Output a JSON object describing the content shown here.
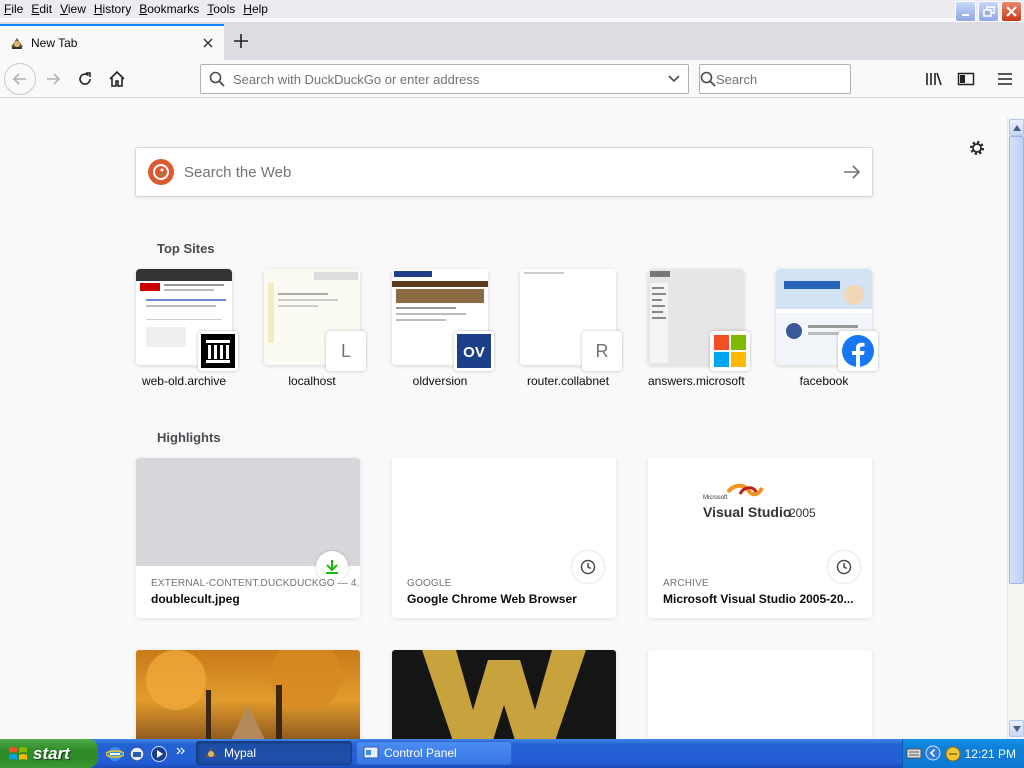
{
  "menu": [
    {
      "label": "File",
      "key": "F",
      "rest": "ile"
    },
    {
      "label": "Edit",
      "key": "E",
      "rest": "dit"
    },
    {
      "label": "View",
      "key": "V",
      "rest": "iew"
    },
    {
      "label": "History",
      "key": "H",
      "rest": "istory"
    },
    {
      "label": "Bookmarks",
      "key": "B",
      "rest": "ookmarks"
    },
    {
      "label": "Tools",
      "key": "T",
      "rest": "ools"
    },
    {
      "label": "Help",
      "key": "H",
      "rest": "elp"
    }
  ],
  "tab": {
    "title": "New Tab"
  },
  "urlbar": {
    "placeholder": "Search with DuckDuckGo or enter address"
  },
  "searchbar": {
    "placeholder": "Search"
  },
  "websearch": {
    "placeholder": "Search the Web"
  },
  "sections": {
    "top_sites": "Top Sites",
    "highlights": "Highlights"
  },
  "top_sites": [
    {
      "label": "web-old.archive",
      "icon": "archive-icon"
    },
    {
      "label": "localhost",
      "icon": "letter-icon",
      "letter": "L"
    },
    {
      "label": "oldversion",
      "icon": "oldversion-icon",
      "letter": "OV"
    },
    {
      "label": "router.collabnet",
      "icon": "letter-icon",
      "letter": "R"
    },
    {
      "label": "answers.microsoft",
      "icon": "microsoft-icon"
    },
    {
      "label": "facebook",
      "icon": "facebook-icon"
    }
  ],
  "highlights": [
    {
      "source": "EXTERNAL-CONTENT.DUCKDUCKGO — 4...",
      "title": "doublecult.jpeg",
      "badge": "download-icon"
    },
    {
      "source": "GOOGLE",
      "title": "Google Chrome Web Browser",
      "badge": "clock-icon"
    },
    {
      "source": "ARCHIVE",
      "title": "Microsoft Visual Studio 2005-20...",
      "badge": "clock-icon",
      "preview_brand": "Microsoft",
      "preview_product": "Visual Studio",
      "preview_year": "2005"
    }
  ],
  "taskbar": {
    "start": "start",
    "tasks": [
      {
        "label": "Mypal",
        "active": true
      },
      {
        "label": "Control Panel",
        "active": false
      }
    ],
    "clock": "12:21 PM"
  },
  "colors": {
    "accent": "#0a84ff",
    "ddg": "#de5833",
    "download": "#12bc00",
    "facebook": "#1877f2"
  }
}
